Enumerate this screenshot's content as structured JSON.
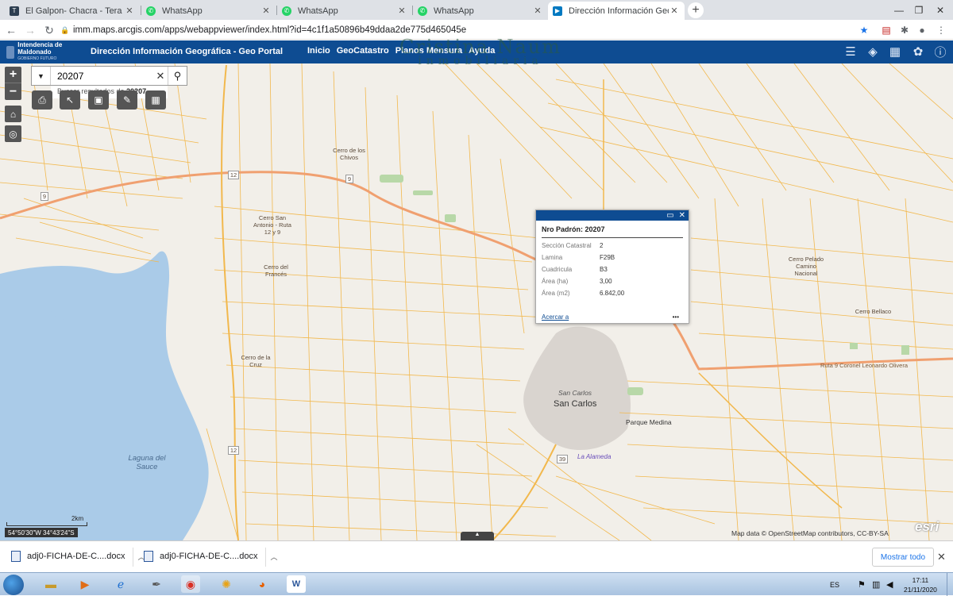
{
  "browser": {
    "tabs": [
      {
        "title": "El Galpon- Chacra - Tera CRM",
        "icon": "tera-icon",
        "color": "#2d3e50"
      },
      {
        "title": "WhatsApp",
        "icon": "whatsapp-icon",
        "color": "#25d366"
      },
      {
        "title": "WhatsApp",
        "icon": "whatsapp-icon",
        "color": "#25d366"
      },
      {
        "title": "WhatsApp",
        "icon": "whatsapp-icon",
        "color": "#25d366"
      },
      {
        "title": "Dirección Información Geográfica",
        "icon": "arcgis-icon",
        "color": "#0079c1"
      }
    ],
    "url": "imm.maps.arcgis.com/apps/webappviewer/index.html?id=4c1f1a50896b49ddaa2de775d465045e"
  },
  "app": {
    "logo_text": "Intendencia de Maldonado",
    "logo_sub": "GOBIERNO FUTURO",
    "title": "Dirección Información Geográfica -  Geo Portal",
    "nav": [
      "Inicio",
      "GeoCatastro",
      "Planos Mensura",
      "Ayuda"
    ]
  },
  "watermark": {
    "line1": "Cristina Naum",
    "line2": "inmobiliaria"
  },
  "search": {
    "value": "20207",
    "suggestion_prefix": "Buscar resultados de ",
    "suggestion_term": "20207"
  },
  "popup": {
    "title": "Nro Padrón: 20207",
    "rows": [
      {
        "k": "Sección Catastral",
        "v": "2"
      },
      {
        "k": "Lamina",
        "v": "F29B"
      },
      {
        "k": "Cuadricula",
        "v": "B3"
      },
      {
        "k": "Área (ha)",
        "v": "3,00"
      },
      {
        "k": "Área (m2)",
        "v": "6.842,00"
      }
    ],
    "zoom_link": "Acercar a",
    "more": "•••"
  },
  "map": {
    "places": {
      "cerro_chivos": "Cerro de los Chivos",
      "cerro_san_antonio": "Cerro San Antonio - Ruta 12 y 9",
      "cerro_frances": "Cerro del Francés",
      "cerro_cruz": "Cerro de la Cruz",
      "cerro_pelado": "Cerro Pelado Camino Nacional",
      "cerro_bellaco": "Cerro Bellaco",
      "laguna": "Laguna del Sauce",
      "san_carlos_italic": "San Carlos",
      "san_carlos": "San Carlos",
      "parque_medina": "Parque Medina",
      "la_alameda": "La Alameda",
      "ruta9_label": "Ruta 9 Coronel Leonardo Olivera",
      "route_9": "9",
      "route_12": "12",
      "route_39": "39"
    },
    "scale": "2km",
    "coords": "54°50'30\"W 34°43'24\"S",
    "attribution": "Map data © OpenStreetMap contributors, CC-BY-SA",
    "esri": "esri"
  },
  "downloads": {
    "items": [
      "adj0-FICHA-DE-C....docx",
      "adj0-FICHA-DE-C....docx"
    ],
    "show_all": "Mostrar todo"
  },
  "taskbar": {
    "lang": "ES",
    "time": "17:11",
    "date": "21/11/2020"
  },
  "colors": {
    "header": "#0e4c92",
    "road": "#f2b84d",
    "highway": "#f0a070",
    "water": "#aacbe8"
  }
}
